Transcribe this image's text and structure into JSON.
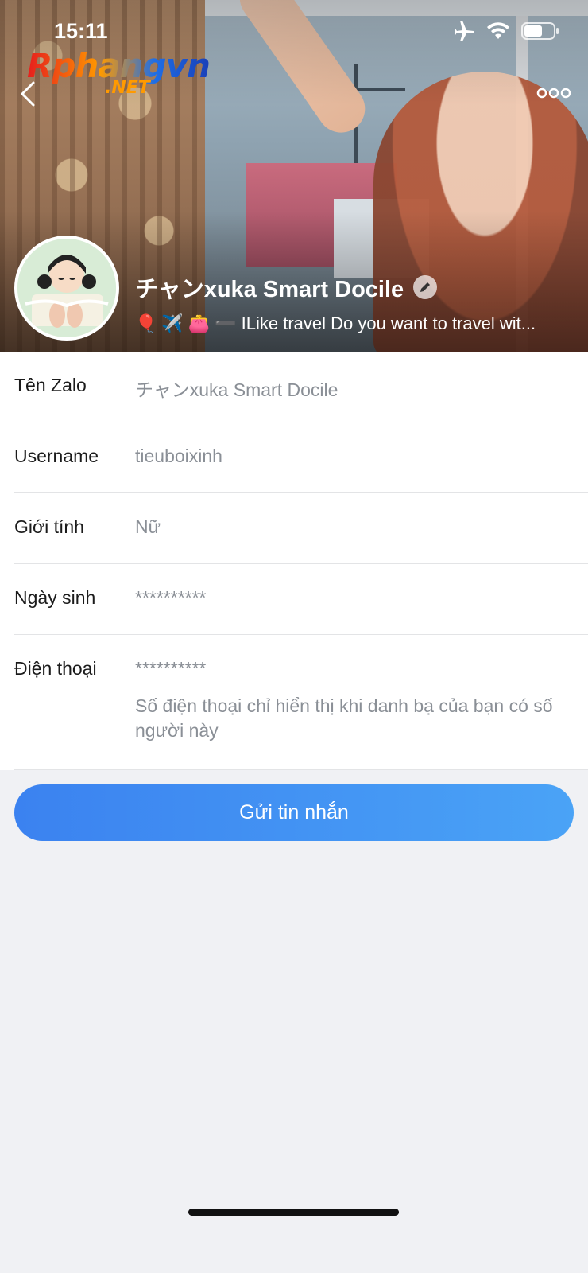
{
  "status_bar": {
    "time": "15:11",
    "icons": [
      "airplane-icon",
      "wifi-icon",
      "battery-icon"
    ]
  },
  "watermark": {
    "main": "Rphangvn",
    "sub": ".NET"
  },
  "header": {
    "back_icon": "chevron-left-icon",
    "more_icon": "more-dots-icon"
  },
  "profile": {
    "name": "チャンxuka Smart Docile",
    "status": "ILike travel Do you want to travel wit...",
    "status_emojis": [
      "🎈",
      "✈️",
      "👛",
      "➖"
    ],
    "edit_icon": "pencil-icon"
  },
  "info": {
    "rows": [
      {
        "label": "Tên Zalo",
        "value": "チャンxuka Smart Docile"
      },
      {
        "label": "Username",
        "value": "tieuboixinh"
      },
      {
        "label": "Giới tính",
        "value": "Nữ"
      },
      {
        "label": "Ngày sinh",
        "value": "**********"
      },
      {
        "label": "Điện thoại",
        "value": "**********",
        "note": "Số điện thoại chỉ hiển thị khi danh bạ của bạn có số người này"
      }
    ]
  },
  "actions": {
    "send_message": "Gửi tin nhắn"
  },
  "colors": {
    "accent_start": "#3b82f0",
    "accent_end": "#4aa3f6",
    "muted_text": "#8a8f96",
    "page_bg": "#f0f1f4"
  }
}
